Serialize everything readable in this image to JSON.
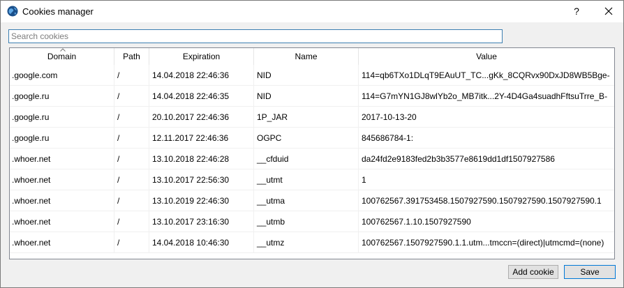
{
  "window": {
    "title": "Cookies manager",
    "help_label": "?"
  },
  "search": {
    "placeholder": "Search cookies",
    "value": ""
  },
  "table": {
    "columns": [
      "Domain",
      "Path",
      "Expiration",
      "Name",
      "Value"
    ],
    "rows": [
      [
        ".google.com",
        "/",
        "14.04.2018 22:46:36",
        "NID",
        "114=qb6TXo1DLqT9EAuUT_TC...gKk_8CQRvx90DxJD8WB5Bge-"
      ],
      [
        ".google.ru",
        "/",
        "14.04.2018 22:46:35",
        "NID",
        "114=G7mYN1GJ8wlYb2o_MB7itk...2Y-4D4Ga4suadhFftsuTrre_B-"
      ],
      [
        ".google.ru",
        "/",
        "20.10.2017 22:46:36",
        "1P_JAR",
        "2017-10-13-20"
      ],
      [
        ".google.ru",
        "/",
        "12.11.2017 22:46:36",
        "OGPC",
        "845686784-1:"
      ],
      [
        ".whoer.net",
        "/",
        "13.10.2018 22:46:28",
        "__cfduid",
        "da24fd2e9183fed2b3b3577e8619dd1df1507927586"
      ],
      [
        ".whoer.net",
        "/",
        "13.10.2017 22:56:30",
        "__utmt",
        "1"
      ],
      [
        ".whoer.net",
        "/",
        "13.10.2019 22:46:30",
        "__utma",
        "100762567.391753458.1507927590.1507927590.1507927590.1"
      ],
      [
        ".whoer.net",
        "/",
        "13.10.2017 23:16:30",
        "__utmb",
        "100762567.1.10.1507927590"
      ],
      [
        ".whoer.net",
        "/",
        "14.04.2018 10:46:30",
        "__utmz",
        "100762567.1507927590.1.1.utm...tmccn=(direct)|utmcmd=(none)"
      ]
    ]
  },
  "buttons": {
    "add_cookie": "Add cookie",
    "save": "Save"
  }
}
